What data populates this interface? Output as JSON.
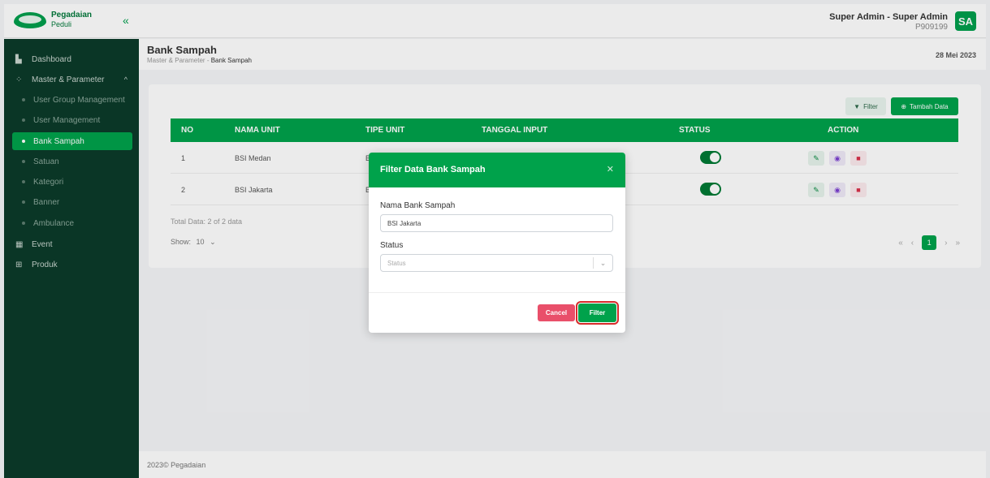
{
  "app": {
    "logo_line1": "Pegadaian",
    "logo_line2": "Peduli",
    "user_name": "Super Admin - Super Admin",
    "user_id": "P909199",
    "avatar_initials": "SA",
    "brand_color": "#00a24b"
  },
  "sidebar": {
    "items": [
      {
        "label": "Dashboard"
      },
      {
        "label": "Master & Parameter"
      },
      {
        "label": "User Group Management"
      },
      {
        "label": "User Management"
      },
      {
        "label": "Bank Sampah"
      },
      {
        "label": "Satuan"
      },
      {
        "label": "Kategori"
      },
      {
        "label": "Banner"
      },
      {
        "label": "Ambulance"
      },
      {
        "label": "Event"
      },
      {
        "label": "Produk"
      }
    ]
  },
  "header": {
    "title": "Bank Sampah",
    "breadcrumb_parent": "Master & Parameter",
    "breadcrumb_sep": "-",
    "breadcrumb_current": "Bank Sampah",
    "date": "28 Mei 2023"
  },
  "toolbar": {
    "filter_label": "Filter",
    "add_label": "Tambah Data"
  },
  "table": {
    "columns": [
      "NO",
      "NAMA UNIT",
      "TIPE UNIT",
      "TANGGAL INPUT",
      "STATUS",
      "ACTION"
    ],
    "rows": [
      {
        "no": "1",
        "nama": "BSI Medan",
        "tipe": "B"
      },
      {
        "no": "2",
        "nama": "BSI Jakarta",
        "tipe": "B"
      }
    ],
    "total": "Total Data: 2 of 2 data",
    "show_label": "Show:",
    "show_value": "10",
    "current_page": "1"
  },
  "footer": {
    "text": "2023© Pegadaian"
  },
  "modal": {
    "title": "Filter Data Bank Sampah",
    "name_label": "Nama Bank Sampah",
    "name_value": "BSI Jakarta",
    "status_label": "Status",
    "status_placeholder": "Status",
    "cancel_label": "Cancel",
    "apply_label": "Filter"
  }
}
